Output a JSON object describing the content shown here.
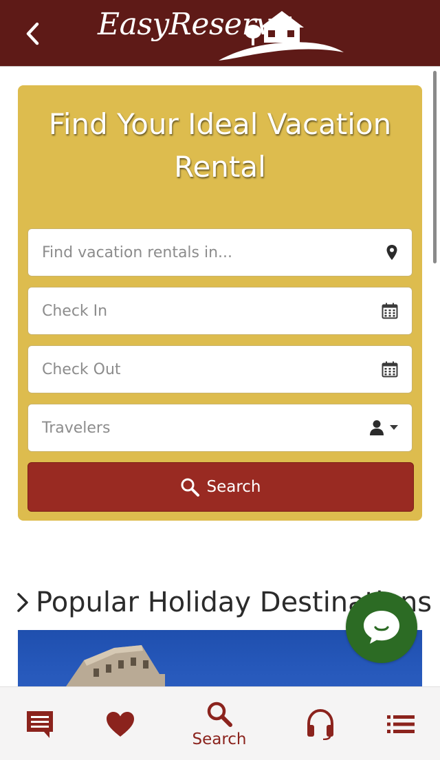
{
  "header": {
    "back_icon": "chevron-left-icon",
    "logo_text": "EasyReserve",
    "logo_icon": "house-icon",
    "background_color": "#5e1a17"
  },
  "search_card": {
    "title": "Find Your Ideal Vacation Rental",
    "background_color": "#ddbc4e",
    "fields": {
      "location": {
        "placeholder": "Find vacation rentals in...",
        "icon": "map-pin-icon"
      },
      "check_in": {
        "placeholder": "Check In",
        "icon": "calendar-icon"
      },
      "check_out": {
        "placeholder": "Check Out",
        "icon": "calendar-icon"
      },
      "travelers": {
        "placeholder": "Travelers",
        "icon": "user-icon",
        "dropdown_icon": "caret-down-icon"
      }
    },
    "search_button": {
      "label": "Search",
      "icon": "search-icon",
      "color": "#992a22"
    }
  },
  "popular": {
    "heading": "Popular Holiday Destinations",
    "heading_icon": "chevron-right-icon"
  },
  "chat": {
    "icon": "chat-bubble-icon",
    "color": "#2c6b24"
  },
  "bottom_nav": {
    "items": [
      {
        "icon": "message-icon",
        "label": ""
      },
      {
        "icon": "heart-icon",
        "label": ""
      },
      {
        "icon": "search-icon",
        "label": "Search",
        "active": true
      },
      {
        "icon": "headset-icon",
        "label": ""
      },
      {
        "icon": "list-icon",
        "label": ""
      }
    ],
    "color": "#8b231d"
  }
}
